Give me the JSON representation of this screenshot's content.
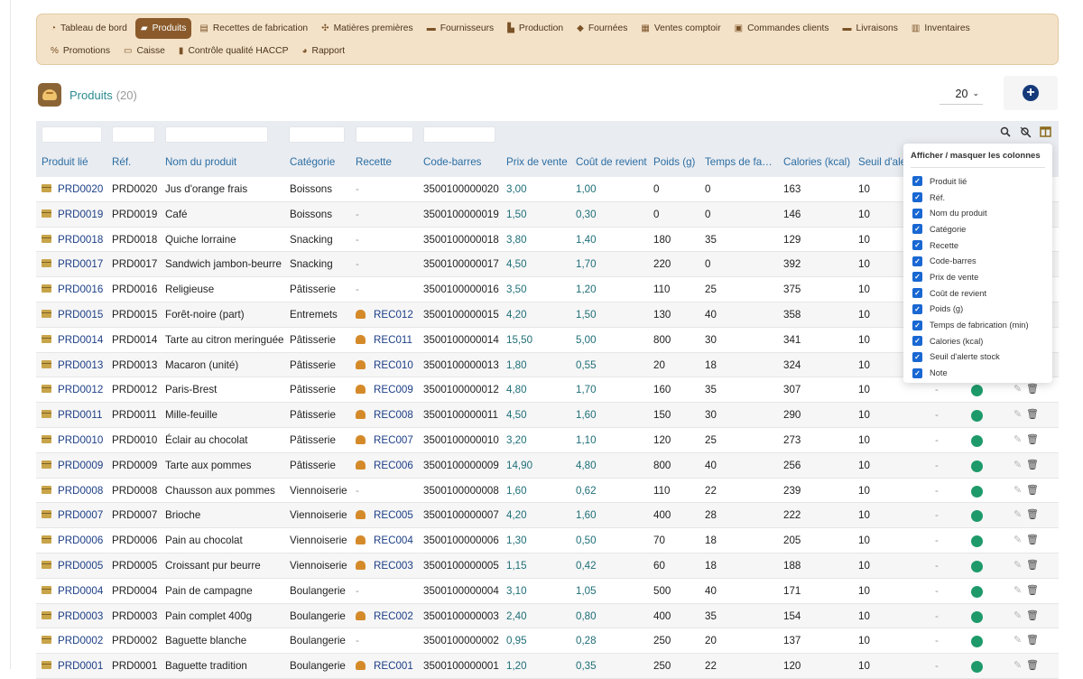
{
  "nav": {
    "row1": [
      {
        "label": "Tableau de bord",
        "icon": "gauge-icon",
        "glyph": "◔",
        "active": false
      },
      {
        "label": "Produits",
        "icon": "bread-icon",
        "glyph": "▰",
        "active": true
      },
      {
        "label": "Recettes de fabrication",
        "icon": "book-icon",
        "glyph": "▤",
        "active": false
      },
      {
        "label": "Matières premières",
        "icon": "wheat-icon",
        "glyph": "✣",
        "active": false
      },
      {
        "label": "Fournisseurs",
        "icon": "truck-icon",
        "glyph": "▬",
        "active": false
      },
      {
        "label": "Production",
        "icon": "factory-icon",
        "glyph": "▙",
        "active": false
      },
      {
        "label": "Fournées",
        "icon": "flame-icon",
        "glyph": "◆",
        "active": false
      },
      {
        "label": "Ventes comptoir",
        "icon": "shop-icon",
        "glyph": "▦",
        "active": false
      },
      {
        "label": "Commandes clients",
        "icon": "clipboard-icon",
        "glyph": "▣",
        "active": false
      },
      {
        "label": "Livraisons",
        "icon": "delivery-truck-icon",
        "glyph": "▬",
        "active": false
      },
      {
        "label": "Inventaires",
        "icon": "inventory-icon",
        "glyph": "▥",
        "active": false
      }
    ],
    "row2": [
      {
        "label": "Promotions",
        "icon": "percent-icon",
        "glyph": "%",
        "active": false
      },
      {
        "label": "Caisse",
        "icon": "cash-icon",
        "glyph": "▭",
        "active": false
      },
      {
        "label": "Contrôle qualité HACCP",
        "icon": "thermometer-icon",
        "glyph": "▮",
        "active": false
      },
      {
        "label": "Rapport",
        "icon": "pie-chart-icon",
        "glyph": "◕",
        "active": false
      }
    ]
  },
  "header": {
    "title": "Produits",
    "count": "(20)",
    "per_page": "20"
  },
  "columns": [
    "Produit lié",
    "Réf.",
    "Nom du produit",
    "Catégorie",
    "Recette",
    "Code-barres",
    "Prix de vente",
    "Coût de revient",
    "Poids (g)",
    "Temps de fa…",
    "Calories (kcal)",
    "Seuil d'ale"
  ],
  "panel": {
    "title": "Afficher / masquer les colonnes",
    "options": [
      "Produit lié",
      "Réf.",
      "Nom du produit",
      "Catégorie",
      "Recette",
      "Code-barres",
      "Prix de vente",
      "Coût de revient",
      "Poids (g)",
      "Temps de fabrication (min)",
      "Calories (kcal)",
      "Seuil d'alerte stock",
      "Note"
    ]
  },
  "rows": [
    {
      "linked": "PRD0020",
      "ref": "PRD0020",
      "name": "Jus d'orange frais",
      "category": "Boissons",
      "recipe": "-",
      "barcode": "3500100000020",
      "price": "3,00",
      "cost": "1,00",
      "weight": "0",
      "time": "0",
      "calories": "163",
      "threshold": "10",
      "note": "",
      "status": ""
    },
    {
      "linked": "PRD0019",
      "ref": "PRD0019",
      "name": "Café",
      "category": "Boissons",
      "recipe": "-",
      "barcode": "3500100000019",
      "price": "1,50",
      "cost": "0,30",
      "weight": "0",
      "time": "0",
      "calories": "146",
      "threshold": "10",
      "note": "",
      "status": ""
    },
    {
      "linked": "PRD0018",
      "ref": "PRD0018",
      "name": "Quiche lorraine",
      "category": "Snacking",
      "recipe": "-",
      "barcode": "3500100000018",
      "price": "3,80",
      "cost": "1,40",
      "weight": "180",
      "time": "35",
      "calories": "129",
      "threshold": "10",
      "note": "",
      "status": ""
    },
    {
      "linked": "PRD0017",
      "ref": "PRD0017",
      "name": "Sandwich jambon-beurre",
      "category": "Snacking",
      "recipe": "-",
      "barcode": "3500100000017",
      "price": "4,50",
      "cost": "1,70",
      "weight": "220",
      "time": "0",
      "calories": "392",
      "threshold": "10",
      "note": "",
      "status": ""
    },
    {
      "linked": "PRD0016",
      "ref": "PRD0016",
      "name": "Religieuse",
      "category": "Pâtisserie",
      "recipe": "-",
      "barcode": "3500100000016",
      "price": "3,50",
      "cost": "1,20",
      "weight": "110",
      "time": "25",
      "calories": "375",
      "threshold": "10",
      "note": "",
      "status": ""
    },
    {
      "linked": "PRD0015",
      "ref": "PRD0015",
      "name": "Forêt-noire (part)",
      "category": "Entremets",
      "recipe": "REC012",
      "barcode": "3500100000015",
      "price": "4,20",
      "cost": "1,50",
      "weight": "130",
      "time": "40",
      "calories": "358",
      "threshold": "10",
      "note": "",
      "status": ""
    },
    {
      "linked": "PRD0014",
      "ref": "PRD0014",
      "name": "Tarte au citron meringuée",
      "category": "Pâtisserie",
      "recipe": "REC011",
      "barcode": "3500100000014",
      "price": "15,50",
      "cost": "5,00",
      "weight": "800",
      "time": "30",
      "calories": "341",
      "threshold": "10",
      "note": "",
      "status": ""
    },
    {
      "linked": "PRD0013",
      "ref": "PRD0013",
      "name": "Macaron (unité)",
      "category": "Pâtisserie",
      "recipe": "REC010",
      "barcode": "3500100000013",
      "price": "1,80",
      "cost": "0,55",
      "weight": "20",
      "time": "18",
      "calories": "324",
      "threshold": "10",
      "note": "",
      "status": ""
    },
    {
      "linked": "PRD0012",
      "ref": "PRD0012",
      "name": "Paris-Brest",
      "category": "Pâtisserie",
      "recipe": "REC009",
      "barcode": "3500100000012",
      "price": "4,80",
      "cost": "1,70",
      "weight": "160",
      "time": "35",
      "calories": "307",
      "threshold": "10",
      "note": "-",
      "status": "active"
    },
    {
      "linked": "PRD0011",
      "ref": "PRD0011",
      "name": "Mille-feuille",
      "category": "Pâtisserie",
      "recipe": "REC008",
      "barcode": "3500100000011",
      "price": "4,50",
      "cost": "1,60",
      "weight": "150",
      "time": "30",
      "calories": "290",
      "threshold": "10",
      "note": "-",
      "status": "active"
    },
    {
      "linked": "PRD0010",
      "ref": "PRD0010",
      "name": "Éclair au chocolat",
      "category": "Pâtisserie",
      "recipe": "REC007",
      "barcode": "3500100000010",
      "price": "3,20",
      "cost": "1,10",
      "weight": "120",
      "time": "25",
      "calories": "273",
      "threshold": "10",
      "note": "-",
      "status": "active"
    },
    {
      "linked": "PRD0009",
      "ref": "PRD0009",
      "name": "Tarte aux pommes",
      "category": "Pâtisserie",
      "recipe": "REC006",
      "barcode": "3500100000009",
      "price": "14,90",
      "cost": "4,80",
      "weight": "800",
      "time": "40",
      "calories": "256",
      "threshold": "10",
      "note": "-",
      "status": "active"
    },
    {
      "linked": "PRD0008",
      "ref": "PRD0008",
      "name": "Chausson aux pommes",
      "category": "Viennoiserie",
      "recipe": "-",
      "barcode": "3500100000008",
      "price": "1,60",
      "cost": "0,62",
      "weight": "110",
      "time": "22",
      "calories": "239",
      "threshold": "10",
      "note": "-",
      "status": "active"
    },
    {
      "linked": "PRD0007",
      "ref": "PRD0007",
      "name": "Brioche",
      "category": "Viennoiserie",
      "recipe": "REC005",
      "barcode": "3500100000007",
      "price": "4,20",
      "cost": "1,60",
      "weight": "400",
      "time": "28",
      "calories": "222",
      "threshold": "10",
      "note": "-",
      "status": "active"
    },
    {
      "linked": "PRD0006",
      "ref": "PRD0006",
      "name": "Pain au chocolat",
      "category": "Viennoiserie",
      "recipe": "REC004",
      "barcode": "3500100000006",
      "price": "1,30",
      "cost": "0,50",
      "weight": "70",
      "time": "18",
      "calories": "205",
      "threshold": "10",
      "note": "-",
      "status": "active"
    },
    {
      "linked": "PRD0005",
      "ref": "PRD0005",
      "name": "Croissant pur beurre",
      "category": "Viennoiserie",
      "recipe": "REC003",
      "barcode": "3500100000005",
      "price": "1,15",
      "cost": "0,42",
      "weight": "60",
      "time": "18",
      "calories": "188",
      "threshold": "10",
      "note": "-",
      "status": "active"
    },
    {
      "linked": "PRD0004",
      "ref": "PRD0004",
      "name": "Pain de campagne",
      "category": "Boulangerie",
      "recipe": "-",
      "barcode": "3500100000004",
      "price": "3,10",
      "cost": "1,05",
      "weight": "500",
      "time": "40",
      "calories": "171",
      "threshold": "10",
      "note": "-",
      "status": "active"
    },
    {
      "linked": "PRD0003",
      "ref": "PRD0003",
      "name": "Pain complet 400g",
      "category": "Boulangerie",
      "recipe": "REC002",
      "barcode": "3500100000003",
      "price": "2,40",
      "cost": "0,80",
      "weight": "400",
      "time": "35",
      "calories": "154",
      "threshold": "10",
      "note": "-",
      "status": "active"
    },
    {
      "linked": "PRD0002",
      "ref": "PRD0002",
      "name": "Baguette blanche",
      "category": "Boulangerie",
      "recipe": "-",
      "barcode": "3500100000002",
      "price": "0,95",
      "cost": "0,28",
      "weight": "250",
      "time": "20",
      "calories": "137",
      "threshold": "10",
      "note": "-",
      "status": "active"
    },
    {
      "linked": "PRD0001",
      "ref": "PRD0001",
      "name": "Baguette tradition",
      "category": "Boulangerie",
      "recipe": "REC001",
      "barcode": "3500100000001",
      "price": "1,20",
      "cost": "0,35",
      "weight": "250",
      "time": "22",
      "calories": "120",
      "threshold": "10",
      "note": "-",
      "status": "active"
    }
  ],
  "colors": {
    "accent": "#8a5a2b",
    "title": "#2a8a8f",
    "link": "#1d3f86",
    "money": "#1f6f78",
    "status_active": "#1e9a6a",
    "checkbox": "#1967d2"
  }
}
